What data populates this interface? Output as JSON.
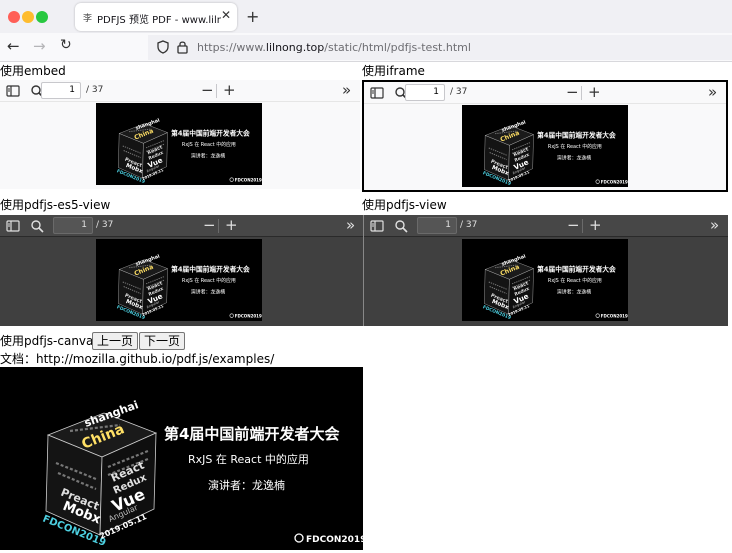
{
  "browser": {
    "tab_title": "PDFJS 预览 PDF - www.lilnong.top",
    "url_host_prefix": "https://www.",
    "url_domain": "lilnong.top",
    "url_path": "/static/html/pdfjs-test.html",
    "traffic_colors": [
      "#ff5f57",
      "#febc2e",
      "#28c840"
    ],
    "favicon_glyph": "李"
  },
  "sections": {
    "embed_label": "使用embed",
    "iframe_label": "使用iframe",
    "es5_label": "使用pdfjs-es5-view",
    "view_label": "使用pdfjs-view",
    "canvas_label": "使用pdfjs-canvas"
  },
  "viewer": {
    "page_number": "1",
    "total_pages": "/ 37"
  },
  "buttons": {
    "prev": "上一页",
    "next": "下一页"
  },
  "doc_line": "文档：http://mozilla.github.io/pdf.js/examples/",
  "slide": {
    "title": "第4届中国前端开发者大会",
    "subtitle": "RxJS 在 React 中的应用",
    "speaker": "演讲者：龙逸楠",
    "logo": "FDCON2019",
    "cube_words": [
      "shanghai",
      "China",
      "React",
      "Redux",
      "Vue",
      "Angular",
      "Mobx",
      "Preact",
      "FDCON2019",
      "2019.05.11"
    ]
  }
}
